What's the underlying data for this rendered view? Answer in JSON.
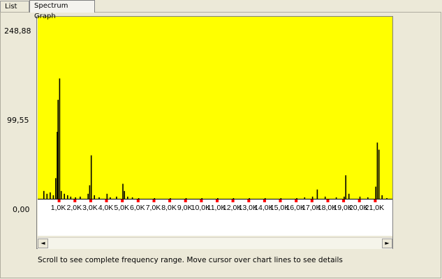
{
  "tabs": [
    {
      "label": "List"
    },
    {
      "label": "Spectrum Graph"
    }
  ],
  "y_axis_labels": {
    "top": "248,88",
    "mid": "99,55",
    "zero": "0,00"
  },
  "footer": {
    "hint": "Scroll to see complete frequency range.  Move cursor over chart lines to see details"
  },
  "scrollbar": {
    "left_arrow": "◄",
    "right_arrow": "►"
  },
  "colors": {
    "plot_background": "#ffff00",
    "bar_color": "#000000",
    "tick_marker": "#ff0000"
  },
  "chart_data": {
    "type": "bar",
    "title": "",
    "xlabel": "",
    "ylabel": "",
    "ylim": [
      0,
      248.88
    ],
    "x_tick_labels": [
      "1,0K",
      "2,0K",
      "3,0K",
      "4,0K",
      "5,0K",
      "6,0K",
      "7,0K",
      "8,0K",
      "9,0K",
      "10,0K",
      "11,0K",
      "12,0K",
      "13,0K",
      "14,0K",
      "15,0K",
      "16,0K",
      "17,0K",
      "18,0K",
      "19,0K",
      "20,0K",
      "21,0K"
    ],
    "x_ticks_khz": [
      1,
      2,
      3,
      4,
      5,
      6,
      7,
      8,
      9,
      10,
      11,
      12,
      13,
      14,
      15,
      16,
      17,
      18,
      19,
      20,
      21
    ],
    "x_range_khz": [
      0,
      22
    ],
    "bins_khz": [
      0.0,
      0.2,
      0.4,
      0.6,
      0.75,
      0.85,
      0.9,
      1.0,
      1.1,
      1.3,
      1.5,
      1.7,
      2.0,
      2.3,
      2.8,
      2.9,
      3.0,
      3.2,
      3.5,
      4.0,
      4.2,
      4.6,
      5.0,
      5.1,
      5.3,
      5.6,
      6.0,
      7.0,
      8.0,
      9.0,
      10.0,
      11.0,
      12.0,
      13.0,
      14.0,
      15.0,
      16.0,
      16.5,
      17.0,
      17.3,
      17.8,
      18.5,
      19.0,
      19.1,
      19.3,
      20.0,
      20.5,
      21.0,
      21.1,
      21.2,
      21.4,
      21.7
    ],
    "values": [
      12,
      8,
      10,
      6,
      30,
      95,
      140,
      170,
      12,
      8,
      6,
      4,
      3,
      4,
      8,
      20,
      62,
      6,
      3,
      8,
      3,
      4,
      22,
      12,
      4,
      3,
      2,
      2,
      2,
      2,
      2,
      2,
      2,
      2,
      2,
      2,
      2,
      3,
      4,
      14,
      4,
      3,
      4,
      34,
      8,
      4,
      3,
      18,
      80,
      70,
      6,
      2
    ]
  }
}
